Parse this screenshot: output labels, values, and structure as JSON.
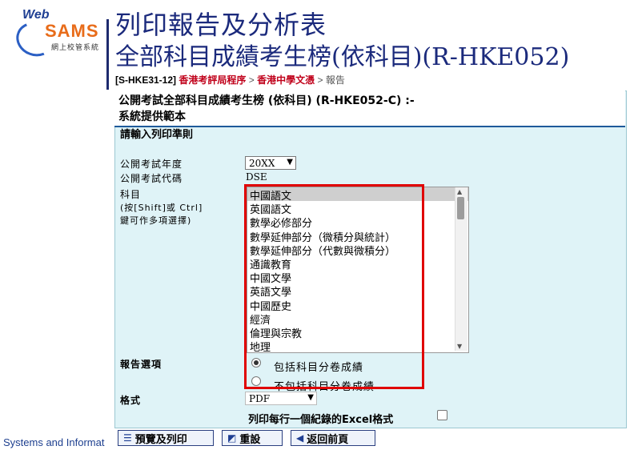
{
  "slide": {
    "logo_web": "Web",
    "logo_sams": "SAMS",
    "logo_sub": "網上校管系統",
    "title_line1": "列印報告及分析表",
    "title_line2": "全部科目成績考生榜(依科目)(R-HKE052)",
    "footer": "Systems and Informat"
  },
  "breadcrumb": {
    "code": "[S-HKE31-12]",
    "step1": "香港考評局程序",
    "sep1": ">",
    "step2": "香港中學文憑",
    "sep2": ">",
    "current": "報告"
  },
  "panel": {
    "header": "公開考試全部科目成績考生榜 (依科目) (R-HKE052-C) :-\n系統提供範本",
    "criteria_label": "請輸入列印準則",
    "exam_year_label": "公開考試年度",
    "exam_year_value": "20XX",
    "exam_code_label": "公開考試代碼",
    "exam_code_value": "DSE",
    "subject_label": "科目",
    "subject_hint1": "(按[Shift]或 Ctrl]",
    "subject_hint2": "鍵可作多項選擇)",
    "subjects": [
      "中國語文",
      "英國語文",
      "數學必修部分",
      "數學延伸部分（微積分與統計）",
      "數學延伸部分（代數與微積分）",
      "通識教育",
      "中國文學",
      "英語文學",
      "中國歷史",
      "經濟",
      "倫理與宗教",
      "地理"
    ],
    "selected_subject_index": 0,
    "report_options_label": "報告選項",
    "option_include": "包括科目分卷成績",
    "option_exclude": "不包括科目分卷成績",
    "format_label": "格式",
    "format_value": "PDF",
    "excel_option": "列印每行一個紀錄的Excel格式"
  },
  "buttons": {
    "preview_print": "預覽及列印",
    "reset": "重設",
    "back": "返回前頁"
  },
  "colors": {
    "panel_bg": "#dff3f7",
    "title_blue": "#1b2a7c",
    "link_red": "#c0001a",
    "highlight_red": "#e00000"
  }
}
